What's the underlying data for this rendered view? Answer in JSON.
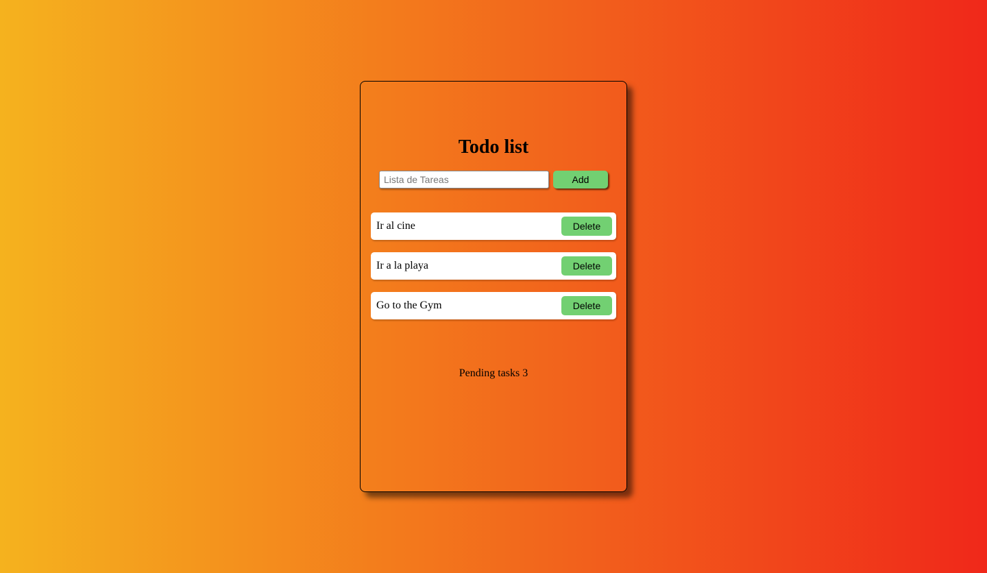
{
  "title": "Todo list",
  "input": {
    "placeholder": "Lista de Tareas",
    "value": ""
  },
  "add_button_label": "Add",
  "tasks": [
    {
      "text": "Ir al cine",
      "delete_label": "Delete"
    },
    {
      "text": "Ir a la playa",
      "delete_label": "Delete"
    },
    {
      "text": "Go to the Gym",
      "delete_label": "Delete"
    }
  ],
  "pending_label": "Pending tasks",
  "pending_count": 3
}
